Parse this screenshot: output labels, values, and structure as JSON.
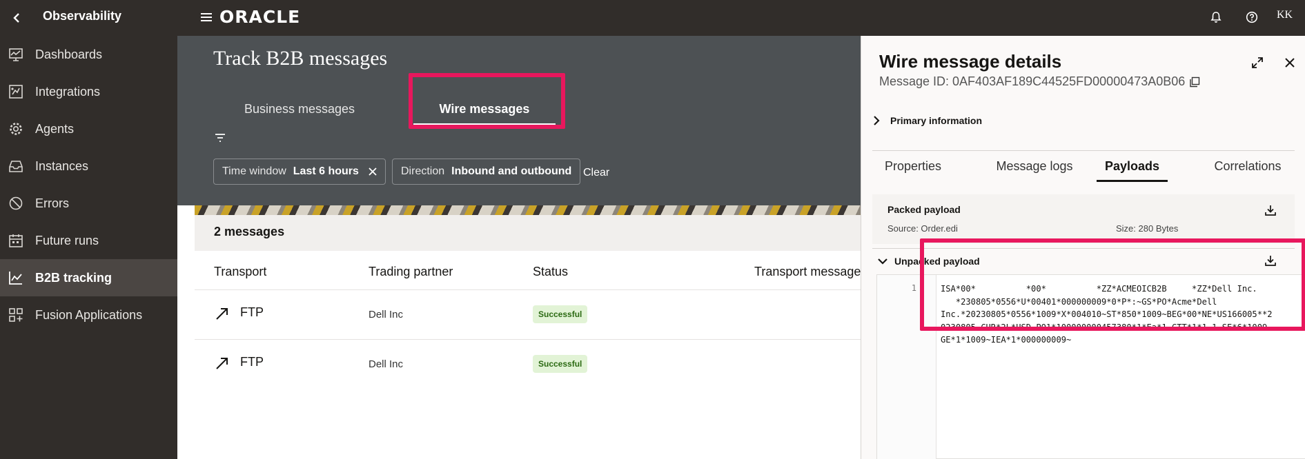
{
  "app": {
    "title": "Observability",
    "logo_text": "ORACLE",
    "user_initials": "KK"
  },
  "sidebar": {
    "items": [
      {
        "label": "Dashboards",
        "icon": "dashboard-icon"
      },
      {
        "label": "Integrations",
        "icon": "integrations-icon"
      },
      {
        "label": "Agents",
        "icon": "gear-icon"
      },
      {
        "label": "Instances",
        "icon": "inbox-icon"
      },
      {
        "label": "Errors",
        "icon": "error-icon"
      },
      {
        "label": "Future runs",
        "icon": "calendar-icon"
      },
      {
        "label": "B2B tracking",
        "icon": "chart-icon",
        "active": true
      },
      {
        "label": "Fusion Applications",
        "icon": "grid-plus-icon"
      }
    ]
  },
  "main": {
    "title": "Track B2B messages",
    "tabs": [
      {
        "label": "Business messages"
      },
      {
        "label": "Wire messages",
        "active": true
      }
    ],
    "filters": [
      {
        "name": "Time window",
        "value": "Last 6 hours",
        "removable": true
      },
      {
        "name": "Direction",
        "value": "Inbound and outbound",
        "removable": false
      }
    ],
    "clear_label": "Clear",
    "count_label": "2 messages",
    "columns": [
      "Transport",
      "Trading partner",
      "Status",
      "Transport message"
    ],
    "rows": [
      {
        "transport": "FTP",
        "partner": "Dell Inc",
        "status": "Successful"
      },
      {
        "transport": "FTP",
        "partner": "Dell Inc",
        "status": "Successful"
      }
    ]
  },
  "drawer": {
    "title": "Wire message details",
    "message_id": "Message ID: 0AF403AF189C44525FD00000473A0B06",
    "primary_info_label": "Primary information",
    "tabs": [
      {
        "label": "Properties"
      },
      {
        "label": "Message logs"
      },
      {
        "label": "Payloads",
        "active": true
      },
      {
        "label": "Correlations"
      }
    ],
    "packed": {
      "title": "Packed payload",
      "source": "Source:  Order.edi",
      "size": "Size:  280 Bytes"
    },
    "unpacked": {
      "title": "Unpacked payload"
    },
    "editor": {
      "line_number": "1",
      "lines": [
        "ISA*00*          *00*          *ZZ*ACMEOICB2B     *ZZ*Dell Inc.",
        "   *230805*0556*U*00401*000000009*0*P*:~GS*PO*Acme*Dell",
        "Inc.*20230805*0556*1009*X*004010~ST*850*1009~BEG*00*NE*US166005**2",
        "0230805~CUR*2L*USD~PO1*100000000457380*1*Ea*1~CTT*1*1.1~SE*6*1009~",
        "GE*1*1009~IEA*1*000000009~"
      ]
    }
  },
  "colors": {
    "highlight": "#e8175d",
    "topbar": "#312d2a",
    "header": "#4d5154",
    "success_bg": "#e2f3d6"
  }
}
